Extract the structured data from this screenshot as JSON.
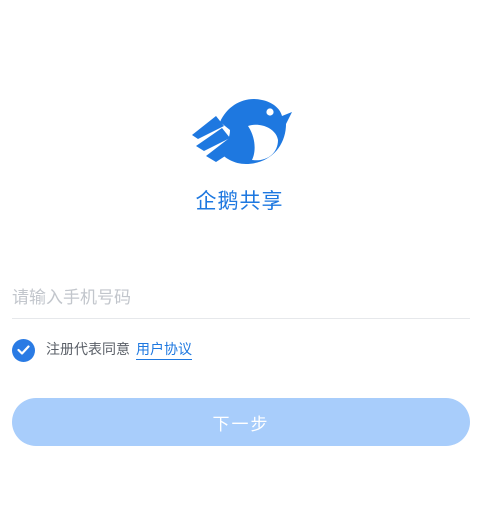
{
  "app": {
    "name": "企鹅共享",
    "logo_icon": "penguin-bird-logo-icon",
    "brand_color": "#1e78e0"
  },
  "login": {
    "phone_placeholder": "请输入手机号码",
    "phone_value": "",
    "agreement_checked": true,
    "agreement_prefix": "注册代表同意",
    "agreement_link": "用户协议",
    "next_button_label": "下一步",
    "next_button_enabled": false,
    "next_button_color": "#a8cdfb",
    "checkbox_color": "#2a7be4"
  }
}
